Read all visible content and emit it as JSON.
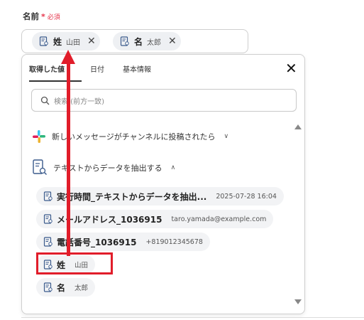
{
  "field": {
    "label": "名前",
    "required_mark": "*",
    "required_text": "必須"
  },
  "selected_chips": [
    {
      "key": "姓",
      "value": "山田",
      "remove": "✕"
    },
    {
      "key": "名",
      "value": "太郎",
      "remove": "✕"
    }
  ],
  "popup": {
    "tabs": [
      {
        "label": "取得した値"
      },
      {
        "label": "日付"
      },
      {
        "label": "基本情報"
      }
    ],
    "close": "✕",
    "search": {
      "placeholder": "検索 (前方一致)"
    },
    "sections": [
      {
        "title": "新しいメッセージがチャンネルに投稿されたら",
        "chevron": "∨",
        "icon": "slack-icon"
      },
      {
        "title": "テキストからデータを抽出する",
        "chevron": "∧",
        "icon": "document-search-icon"
      }
    ],
    "items": [
      {
        "key": "実行時間_テキストからデータを抽出...",
        "value": "2025-07-28 16:04"
      },
      {
        "key": "メールアドレス_1036915",
        "value": "taro.yamada@example.com"
      },
      {
        "key": "電話番号_1036915",
        "value": "+819012345678"
      },
      {
        "key": "姓",
        "value": "山田"
      },
      {
        "key": "名",
        "value": "太郎"
      }
    ]
  },
  "colors": {
    "required": "#e6334a",
    "highlight": "#e11d2a",
    "chip_bg": "#eef0f3"
  }
}
